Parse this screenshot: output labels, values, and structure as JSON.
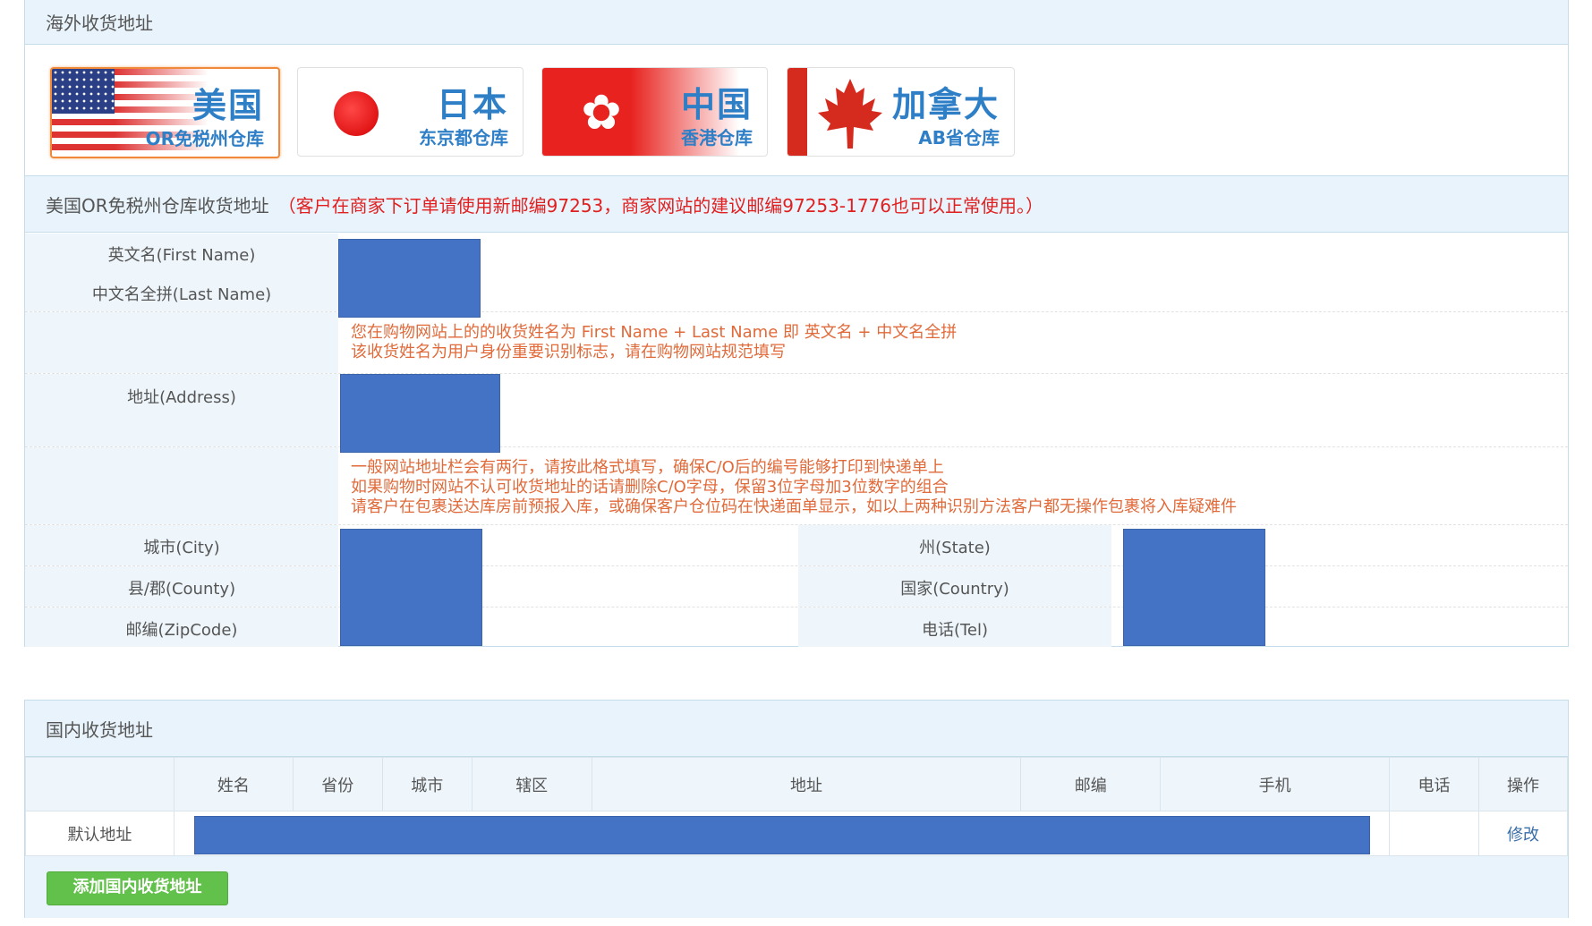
{
  "overseas": {
    "title": "海外收货地址",
    "warehouses": [
      {
        "name": "美国",
        "sub": "OR免税州仓库",
        "flag_icon": "us-flag-icon",
        "active": true
      },
      {
        "name": "日本",
        "sub": "东京都仓库",
        "flag_icon": "japan-flag-icon",
        "active": false
      },
      {
        "name": "中国",
        "sub": "香港仓库",
        "flag_icon": "hongkong-flag-icon",
        "active": false
      },
      {
        "name": "加拿大",
        "sub": "AB省仓库",
        "flag_icon": "canada-flag-icon",
        "active": false
      }
    ],
    "section_title": "美国OR免税州仓库收货地址",
    "section_notice": "（客户在商家下订单请使用新邮编97253，商家网站的建议邮编97253-1776也可以正常使用。）",
    "labels": {
      "first_name": "英文名(First Name)",
      "last_name": "中文名全拼(Last Name)",
      "address": "地址(Address)",
      "city": "城市(City)",
      "county": "县/郡(County)",
      "zipcode": "邮编(ZipCode)",
      "state": "州(State)",
      "country": "国家(Country)",
      "tel": "电话(Tel)"
    },
    "name_notes": [
      "您在购物网站上的的收货姓名为 First Name + Last Name 即 英文名 + 中文名全拼",
      "该收货姓名为用户身份重要识别标志，请在购物网站规范填写"
    ],
    "address_notes": [
      "一般网站地址栏会有两行，请按此格式填写，确保C/O后的编号能够打印到快递单上",
      "如果购物时网站不认可收货地址的话请删除C/O字母，保留3位字母加3位数字的组合",
      "请客户在包裹送达库房前预报入库，或确保客户仓位码在快递面单显示，如以上两种识别方法客户都无操作包裹将入库疑难件"
    ]
  },
  "domestic": {
    "title": "国内收货地址",
    "columns": [
      "姓名",
      "省份",
      "城市",
      "辖区",
      "地址",
      "邮编",
      "手机",
      "电话",
      "操作"
    ],
    "row_label": "默认地址",
    "edit_link": "修改",
    "add_button": "添加国内收货地址"
  },
  "colors": {
    "accent_blue": "#2f7fc7",
    "header_bg": "#e8f3fb",
    "notice_red": "#e02020",
    "note_orange": "#e06a3a",
    "active_border": "#f08a3a",
    "redacted": "#4472c4",
    "add_button": "#62c14a"
  }
}
